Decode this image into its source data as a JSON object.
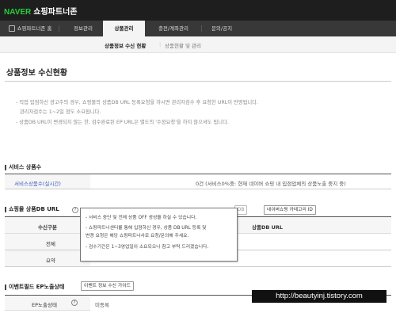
{
  "header": {
    "brand": "NAVER",
    "app_name": "쇼핑파트너존",
    "brand_color": "#25d035"
  },
  "nav": {
    "home": "쇼핑파트너존 홈",
    "items": [
      "정보관리",
      "상품관리",
      "충전/계좌관리",
      "문의/공지"
    ],
    "active": "상품관리"
  },
  "subnav": {
    "items": [
      "상품정보 수신 현황",
      "상품현황 및 관리"
    ],
    "active": "상품정보 수신 현황"
  },
  "page": {
    "title": "상품정보 수신현황"
  },
  "notice": [
    "- 직접 입점하신 광고주의 경우, 쇼핑몰의 상품DB URL 등록요청을 하시면 관리자검수 후 요청한 URL이 반영됩니다.",
    "관리자검수는 1~2일 정도 소요됩니다.",
    "- 상품DB URL이 변경되지 않는 한, 검수완료된 EP URL은 별도의 '수정요청'을 하지 않으셔도 됩니다."
  ],
  "service_status": {
    "section_title": "서비스 상품수",
    "label": "서비스상품수(실시간)",
    "value": "0건 (서비스0%중: 현재 네이버 쇼핑 내 입점업체의 상품노출 중지 중)"
  },
  "db_url": {
    "section_title": "쇼핑몰 상품DB URL",
    "help_icon": "?",
    "button_right_partial": "DB",
    "button_category": "네이버쇼핑 카테고리 ID",
    "col_type": "수신구분",
    "col_url": "상품DB URL",
    "rows": [
      "전체",
      "요약"
    ]
  },
  "tooltip": {
    "lines": [
      "- 서비스 중단 및 전체 상품 OFF 생성을 하실 수 있습니다.",
      "- 쇼핑파트너센터를 통해 입점하신 경우, 상품 DB URL 등록 및",
      "  변경 요청은 해당 쇼핑파트너사로 요청/문의해 주세요.",
      "- 검수기간은 1~3영업일이 소요되오니 참고 부탁 드리겠습니다."
    ]
  },
  "ep": {
    "section_title": "이벤트필드 EP노출상태",
    "guide_button": "이벤트 정보 수신 가이드",
    "label": "EP노출상태",
    "help_icon": "?",
    "value": "미등록"
  },
  "watermark": "http://beautyinj.tistory.com"
}
